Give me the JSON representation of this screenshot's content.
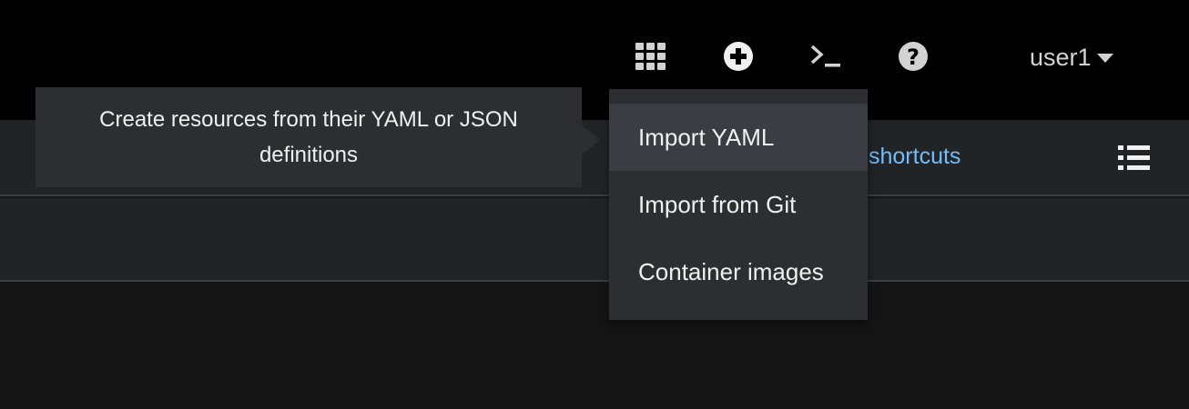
{
  "masthead": {
    "icons": [
      {
        "name": "applications-grid-icon"
      },
      {
        "name": "add-plus-circle-icon"
      },
      {
        "name": "terminal-icon"
      },
      {
        "name": "help-question-icon"
      }
    ],
    "user_label": "user1",
    "background": "#000000"
  },
  "subbar": {
    "shortcuts_link": "shortcuts",
    "link_color": "#73bcf7"
  },
  "tooltip": {
    "text": "Create resources from their YAML or JSON definitions"
  },
  "dropdown": {
    "items": [
      {
        "label": "Import YAML",
        "active": true
      },
      {
        "label": "Import from Git",
        "active": false
      },
      {
        "label": "Container images",
        "active": false
      }
    ]
  }
}
